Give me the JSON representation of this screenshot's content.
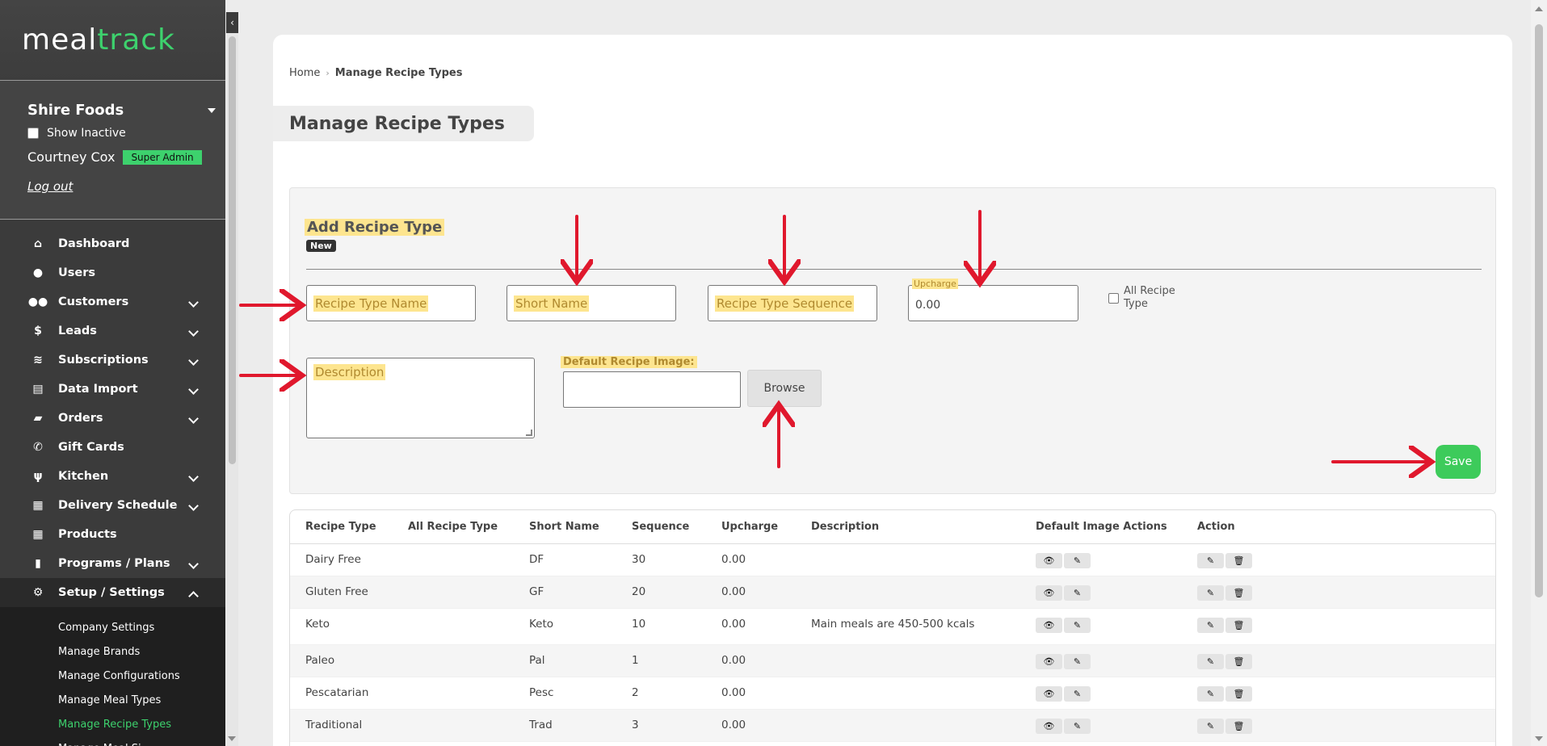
{
  "brand": {
    "part1": "meal",
    "part2": "track"
  },
  "account": {
    "company": "Shire Foods",
    "show_inactive": "Show Inactive",
    "user": "Courtney Cox",
    "role": "Super Admin",
    "logout": "Log out"
  },
  "nav": [
    {
      "label": "Dashboard",
      "icon": "home-icon",
      "glyph": "⌂",
      "chevron": false
    },
    {
      "label": "Users",
      "icon": "user-icon",
      "glyph": "●",
      "chevron": false
    },
    {
      "label": "Customers",
      "icon": "users-icon",
      "glyph": "●●",
      "chevron": true
    },
    {
      "label": "Leads",
      "icon": "dollar-icon",
      "glyph": "$",
      "chevron": true
    },
    {
      "label": "Subscriptions",
      "icon": "layers-icon",
      "glyph": "≋",
      "chevron": true
    },
    {
      "label": "Data Import",
      "icon": "file-icon",
      "glyph": "▤",
      "chevron": true
    },
    {
      "label": "Orders",
      "icon": "bag-icon",
      "glyph": "▰",
      "chevron": true
    },
    {
      "label": "Gift Cards",
      "icon": "phone-icon",
      "glyph": "✆",
      "chevron": false
    },
    {
      "label": "Kitchen",
      "icon": "utensils-icon",
      "glyph": "ψ",
      "chevron": true
    },
    {
      "label": "Delivery Schedule",
      "icon": "calendar-icon",
      "glyph": "▦",
      "chevron": true
    },
    {
      "label": "Products",
      "icon": "calendar-icon",
      "glyph": "▦",
      "chevron": false
    },
    {
      "label": "Programs / Plans",
      "icon": "clipboard-icon",
      "glyph": "▮",
      "chevron": true
    },
    {
      "label": "Setup / Settings",
      "icon": "gear-icon",
      "glyph": "⚙",
      "chevron": true
    }
  ],
  "subnav": [
    "Company Settings",
    "Manage Brands",
    "Manage Configurations",
    "Manage Meal Types",
    "Manage Recipe Types",
    "Manage Meal Si..."
  ],
  "breadcrumb": {
    "home": "Home",
    "current": "Manage Recipe Types"
  },
  "page_title": "Manage Recipe Types",
  "form": {
    "title": "Add Recipe Type",
    "badge": "New",
    "name_ph": "Recipe Type Name",
    "short_ph": "Short Name",
    "seq_ph": "Recipe Type Sequence",
    "upcharge_label": "Upcharge",
    "upcharge_value": "0.00",
    "all_recipe_type": "All Recipe Type",
    "description_ph": "Description",
    "image_label": "Default Recipe Image:",
    "browse": "Browse",
    "save": "Save"
  },
  "table": {
    "headers": [
      "Recipe Type",
      "All Recipe Type",
      "Short Name",
      "Sequence",
      "Upcharge",
      "Description",
      "Default Image Actions",
      "Action"
    ],
    "rows": [
      {
        "type": "Dairy Free",
        "all": "",
        "short": "DF",
        "seq": "30",
        "up": "0.00",
        "desc": ""
      },
      {
        "type": "Gluten Free",
        "all": "",
        "short": "GF",
        "seq": "20",
        "up": "0.00",
        "desc": ""
      },
      {
        "type": "Keto",
        "all": "",
        "short": "Keto",
        "seq": "10",
        "up": "0.00",
        "desc": "Main meals are 450-500 kcals"
      },
      {
        "type": "Paleo",
        "all": "",
        "short": "Pal",
        "seq": "1",
        "up": "0.00",
        "desc": ""
      },
      {
        "type": "Pescatarian",
        "all": "",
        "short": "Pesc",
        "seq": "2",
        "up": "0.00",
        "desc": ""
      },
      {
        "type": "Traditional",
        "all": "",
        "short": "Trad",
        "seq": "3",
        "up": "0.00",
        "desc": ""
      }
    ]
  },
  "colors": {
    "accent": "#3dd16d",
    "sidebar": "#3b3b3b",
    "annotation": "#e0182d",
    "highlight": "#fde58f"
  }
}
